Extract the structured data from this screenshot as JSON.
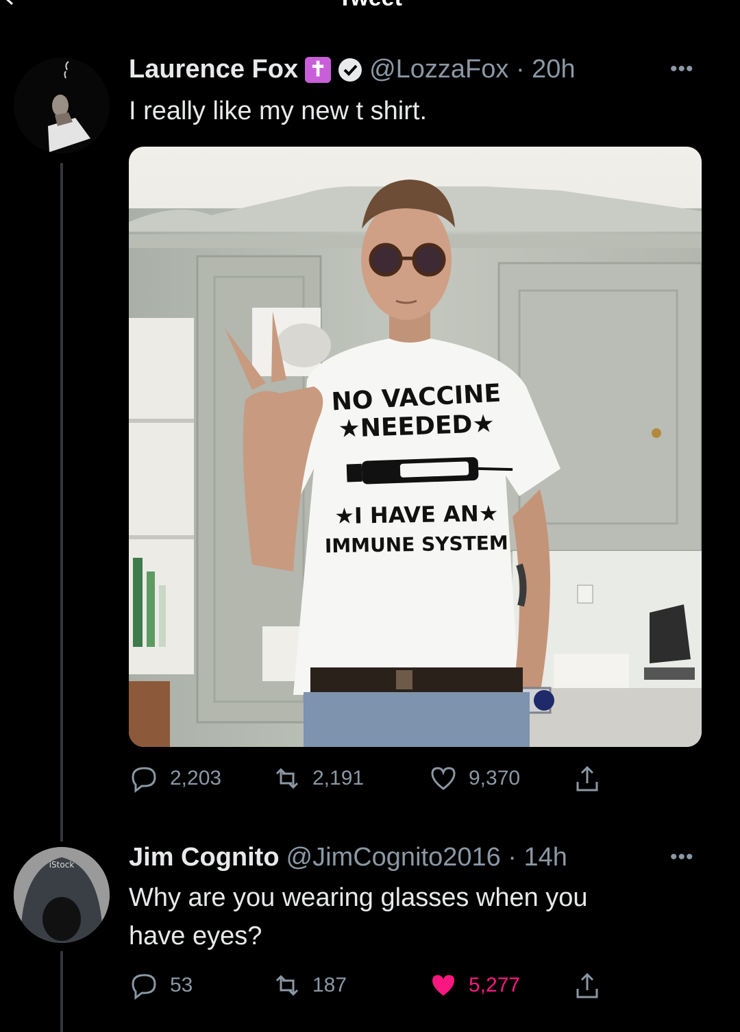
{
  "header": {
    "title": "Tweet"
  },
  "tweet": {
    "author_name": "Laurence Fox",
    "badge": "✝",
    "handle_time": "@LozzaFox · 20h",
    "text": "I really like my new t shirt.",
    "shirt_text": {
      "line1": "NO VACCINE",
      "line2": "★NEEDED★",
      "line3": "★I HAVE AN★",
      "line4": "IMMUNE SYSTEM"
    },
    "replies": "2,203",
    "retweets": "2,191",
    "likes": "9,370"
  },
  "reply": {
    "author_name": "Jim Cognito",
    "handle_time": "@JimCognito2016 · 14h",
    "text_line1": "Why are you wearing glasses when you",
    "text_line2": "have eyes?",
    "avatar_watermark": "iStock",
    "replies": "53",
    "retweets": "187",
    "likes": "5,277"
  },
  "colors": {
    "background": "#000000",
    "text": "#e7e9ea",
    "secondary": "#8b98a5",
    "like_active": "#f91880",
    "badge": "#c85fd8",
    "verified": "#e7e9ea"
  }
}
